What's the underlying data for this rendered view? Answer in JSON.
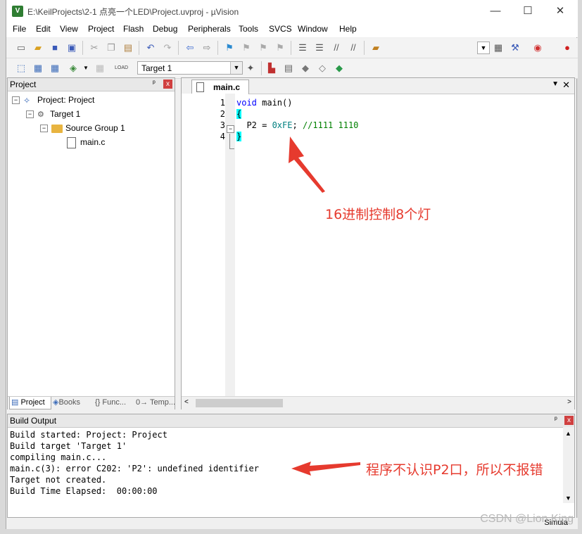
{
  "window": {
    "title": "E:\\KeilProjects\\2-1 点亮一个LED\\Project.uvproj - µVision",
    "app_icon": "V",
    "controls": {
      "minimize": "—",
      "maximize": "☐",
      "close": "✕"
    }
  },
  "menubar": [
    "File",
    "Edit",
    "View",
    "Project",
    "Flash",
    "Debug",
    "Peripherals",
    "Tools",
    "SVCS",
    "Window",
    "Help"
  ],
  "toolbar": {
    "target_select": "Target 1",
    "icons_row1": [
      "new-file-icon",
      "open-icon",
      "save-icon",
      "save-all-icon",
      "cut-icon",
      "copy-icon",
      "paste-icon",
      "undo-icon",
      "redo-icon",
      "nav-back-icon",
      "nav-forward-icon",
      "bookmark-icon",
      "prev-bookmark-icon",
      "next-bookmark-icon",
      "clear-bookmarks-icon",
      "indent-icon",
      "unindent-icon",
      "comment-icon",
      "uncomment-icon",
      "find-in-files-icon",
      "config-wizard-icon",
      "debug-icon",
      "breakpoint-icon"
    ],
    "icons_row2": [
      "translate-icon",
      "build-icon",
      "rebuild-icon",
      "batch-build-icon",
      "stop-build-icon",
      "download-icon",
      "target-options-icon",
      "manage-components-icon",
      "pack-installer-icon",
      "select-pack-icon",
      "manage-env-icon",
      "run-time-env-icon"
    ]
  },
  "project_panel": {
    "title": "Project",
    "pin": "ᵖ",
    "close": "x",
    "tree": [
      {
        "label": "Project: Project",
        "level": 0,
        "icon": "project-icon"
      },
      {
        "label": "Target 1",
        "level": 1,
        "icon": "target-icon"
      },
      {
        "label": "Source Group 1",
        "level": 2,
        "icon": "folder-icon"
      },
      {
        "label": "main.c",
        "level": 3,
        "icon": "file-icon"
      }
    ],
    "tabs": [
      "Project",
      "Books",
      "{} Func...",
      "0→ Temp..."
    ]
  },
  "editor": {
    "tab_label": "main.c",
    "lines": [
      {
        "num": "1",
        "text": "void main()"
      },
      {
        "num": "2",
        "text": "{"
      },
      {
        "num": "3",
        "text": "  P2 = 0xFE; //1111 1110"
      },
      {
        "num": "4",
        "text": "}"
      }
    ],
    "code_parts": {
      "l1_kw": "void",
      "l1_rest": " main()",
      "l3_pre": "  P2 = ",
      "l3_num": "0xFE",
      "l3_mid": "; ",
      "l3_cmt": "//1111 1110"
    }
  },
  "build_output": {
    "title": "Build Output",
    "lines": [
      "Build started: Project: Project",
      "Build target 'Target 1'",
      "compiling main.c...",
      "main.c(3): error C202: 'P2': undefined identifier",
      "Target not created.",
      "Build Time Elapsed:  00:00:00"
    ]
  },
  "statusbar": {
    "text": "Simula"
  },
  "annotations": {
    "hex_note": "16进制控制8个灯",
    "error_note": "程序不认识P2口，所以不报错",
    "color": "#e63a2e"
  },
  "watermark": "CSDN @Lion King"
}
